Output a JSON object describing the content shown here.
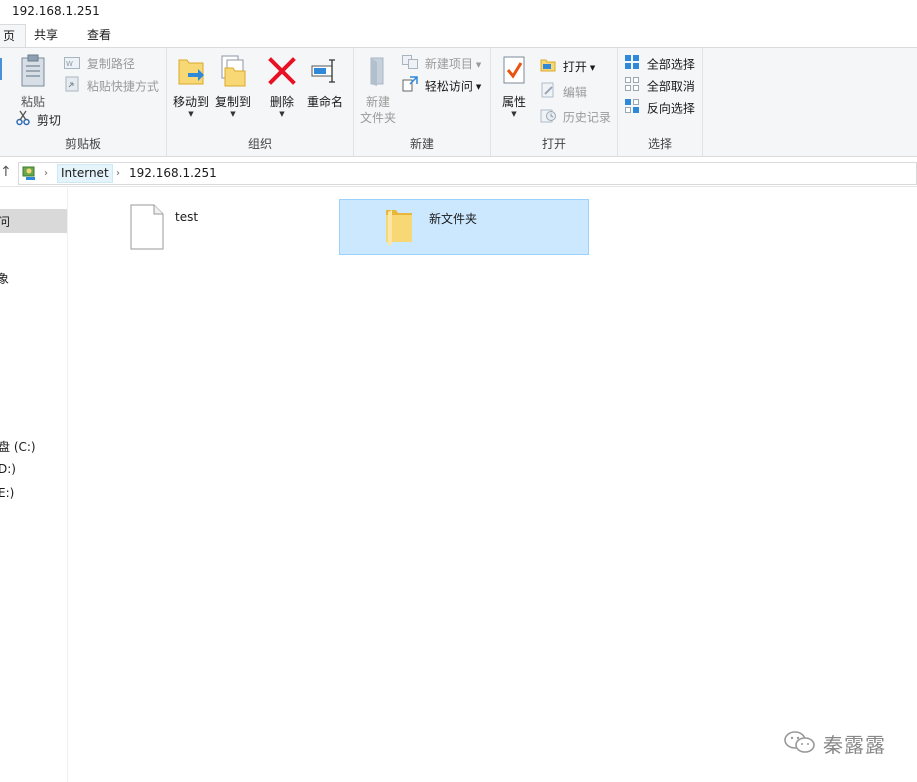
{
  "window": {
    "title": "192.168.1.251"
  },
  "tabs": [
    {
      "label": "页",
      "active": true
    },
    {
      "label": "共享",
      "active": false
    },
    {
      "label": "查看",
      "active": false
    }
  ],
  "ribbon": {
    "clipboard": {
      "group_label": "剪贴板",
      "pin_label": "",
      "paste_label": "粘贴",
      "copy_path_label": "复制路径",
      "paste_shortcut_label": "粘贴快捷方式",
      "cut_label": "剪切"
    },
    "organize": {
      "group_label": "组织",
      "move_to_label": "移动到",
      "copy_to_label": "复制到",
      "delete_label": "删除",
      "rename_label": "重命名"
    },
    "new": {
      "group_label": "新建",
      "new_folder_label_1": "新建",
      "new_folder_label_2": "文件夹",
      "new_item_label": "新建项目",
      "easy_access_label": "轻松访问"
    },
    "open": {
      "group_label": "打开",
      "properties_label": "属性",
      "open_label": "打开",
      "edit_label": "编辑",
      "history_label": "历史记录"
    },
    "select": {
      "group_label": "选择",
      "select_all_label": "全部选择",
      "select_none_label": "全部取消",
      "invert_selection_label": "反向选择"
    }
  },
  "address": {
    "segments": [
      "Internet",
      "192.168.1.251"
    ]
  },
  "nav": {
    "items": [
      "问",
      "象",
      "盘 (C:)",
      "D:)",
      "E:)"
    ]
  },
  "files": [
    {
      "name": "test",
      "type": "file",
      "selected": false
    },
    {
      "name": "新文件夹",
      "type": "folder",
      "selected": true
    }
  ],
  "watermark": {
    "text": "秦露露"
  },
  "colors": {
    "selection_bg": "#cce8ff",
    "selection_border": "#99d1ff",
    "ribbon_bg": "#f5f6f7",
    "delete_red": "#e81123",
    "folder_yellow": "#f8d775"
  }
}
